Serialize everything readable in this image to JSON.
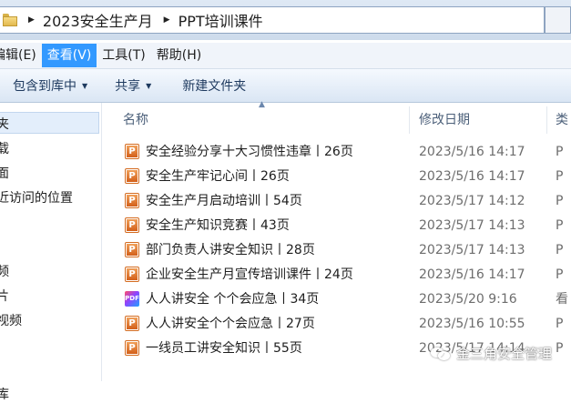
{
  "address": {
    "crumbs": [
      "2023安全生产月",
      "PPT培训课件"
    ]
  },
  "menu": [
    "编辑(E)",
    "查看(V)",
    "工具(T)",
    "帮助(H)"
  ],
  "toolbar": {
    "include": "包含到库中",
    "share": "共享",
    "new_folder": "新建文件夹"
  },
  "nav": {
    "items": [
      "夹",
      "载",
      "面",
      "近访问的位置",
      "",
      "",
      "频",
      "片",
      "视频",
      "",
      "",
      "库",
      ""
    ]
  },
  "columns": {
    "name": "名称",
    "date": "修改日期",
    "type": "类"
  },
  "files": [
    {
      "name": "安全经验分享十大习惯性违章丨26页",
      "date": "2023/5/16 14:17",
      "type": "P",
      "icon": "ppt-file-icon"
    },
    {
      "name": "安全生产牢记心间丨26页",
      "date": "2023/5/16 14:17",
      "type": "P",
      "icon": "ppt-file-icon"
    },
    {
      "name": "安全生产月启动培训丨54页",
      "date": "2023/5/17 14:12",
      "type": "P",
      "icon": "ppt-file-icon"
    },
    {
      "name": "安全生产知识竞赛丨43页",
      "date": "2023/5/17 14:13",
      "type": "P",
      "icon": "ppt-file-icon"
    },
    {
      "name": "部门负责人讲安全知识丨28页",
      "date": "2023/5/17 14:13",
      "type": "P",
      "icon": "ppt-file-icon"
    },
    {
      "name": "企业安全生产月宣传培训课件丨24页",
      "date": "2023/5/16 14:17",
      "type": "P",
      "icon": "ppt-file-icon"
    },
    {
      "name": "人人讲安全 个个会应急丨34页",
      "date": "2023/5/20 9:16",
      "type": "看",
      "icon": "pdf-file-icon"
    },
    {
      "name": "人人讲安全个个会应急丨27页",
      "date": "2023/5/16 10:55",
      "type": "P",
      "icon": "ppt-file-icon"
    },
    {
      "name": "一线员工讲安全知识丨55页",
      "date": "2023/5/17 14:14",
      "type": "P",
      "icon": "ppt-file-icon"
    }
  ],
  "watermark": "金三角安全管理",
  "colors": {
    "menu_active": "#3399ff",
    "nav_selected": "#e3eefb",
    "ppt_icon": "#d3601a"
  }
}
